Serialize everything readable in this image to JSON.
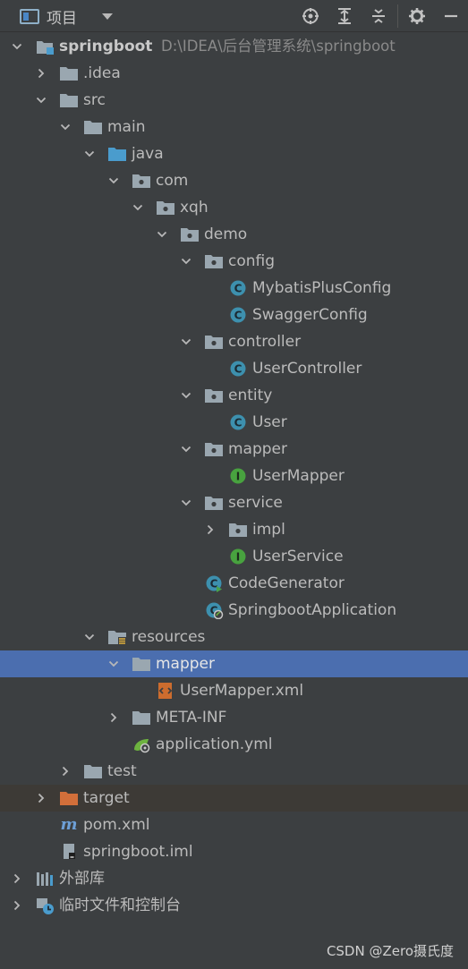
{
  "toolbar": {
    "title": "项目",
    "buttons": [
      "locate-icon",
      "expand-all-icon",
      "collapse-all-icon",
      "gear-icon",
      "minimize-icon"
    ]
  },
  "colors": {
    "background": "#3c3f41",
    "selection": "#4b6eaf",
    "excluded_row": "#3d3a36",
    "folder": "#9aa7b0",
    "source_folder": "#4a9ccd",
    "excluded_folder": "#d26f3a",
    "class_icon": "#3d90ae",
    "interface_icon": "#48a23f"
  },
  "tree": {
    "root_name": "springboot",
    "root_path": "D:\\IDEA\\后台管理系统\\springboot",
    "items": [
      {
        "label": "springboot"
      },
      {
        "label": ".idea"
      },
      {
        "label": "src"
      },
      {
        "label": "main"
      },
      {
        "label": "java"
      },
      {
        "label": "com"
      },
      {
        "label": "xqh"
      },
      {
        "label": "demo"
      },
      {
        "label": "config"
      },
      {
        "label": "MybatisPlusConfig"
      },
      {
        "label": "SwaggerConfig"
      },
      {
        "label": "controller"
      },
      {
        "label": "UserController"
      },
      {
        "label": "entity"
      },
      {
        "label": "User"
      },
      {
        "label": "mapper"
      },
      {
        "label": "UserMapper"
      },
      {
        "label": "service"
      },
      {
        "label": "impl"
      },
      {
        "label": "UserService"
      },
      {
        "label": "CodeGenerator"
      },
      {
        "label": "SpringbootApplication"
      },
      {
        "label": "resources"
      },
      {
        "label": "mapper"
      },
      {
        "label": "UserMapper.xml"
      },
      {
        "label": "META-INF"
      },
      {
        "label": "application.yml"
      },
      {
        "label": "test"
      },
      {
        "label": "target"
      },
      {
        "label": "pom.xml"
      },
      {
        "label": "springboot.iml"
      },
      {
        "label": "外部库"
      },
      {
        "label": "临时文件和控制台"
      }
    ]
  },
  "watermark": "CSDN @Zero摄氏度"
}
